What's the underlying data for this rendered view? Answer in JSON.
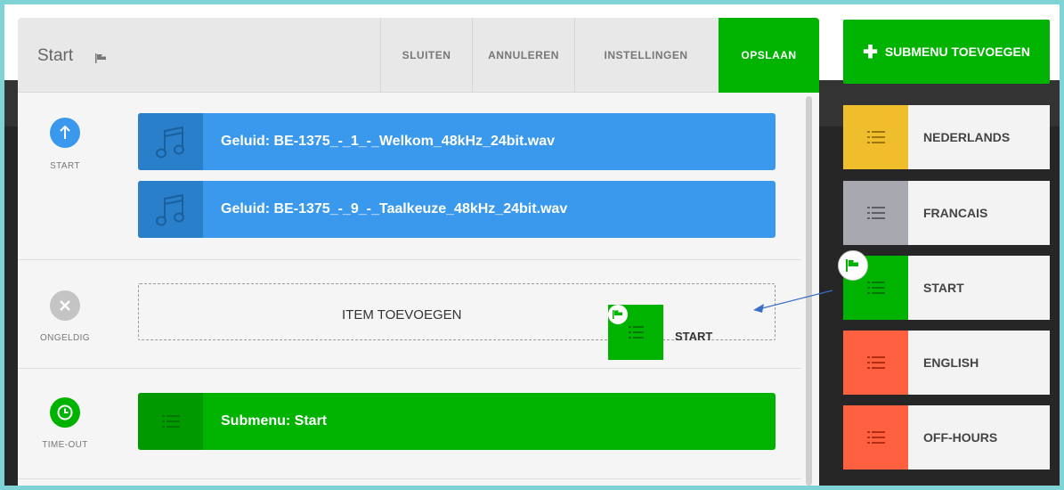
{
  "panel": {
    "title": "Start",
    "header_buttons": [
      {
        "label": "SLUITEN"
      },
      {
        "label": "ANNULEREN"
      },
      {
        "label": "INSTELLINGEN"
      },
      {
        "label": "OPSLAAN"
      }
    ]
  },
  "sections": [
    {
      "label": "START",
      "icon": "arrow-up-icon",
      "items": [
        {
          "text": "Geluid: BE-1375_-_1_-_Welkom_48kHz_24bit.wav",
          "icon": "music-note-icon"
        },
        {
          "text": "Geluid: BE-1375_-_9_-_Taalkeuze_48kHz_24bit.wav",
          "icon": "music-note-icon"
        }
      ]
    },
    {
      "label": "ONGELDIG",
      "icon": "close-icon",
      "dropzone_label": "ITEM TOEVOEGEN",
      "drag_item_label": "START"
    },
    {
      "label": "TIME-OUT",
      "icon": "clock-icon",
      "items": [
        {
          "text": "Submenu: Start",
          "icon": "list-icon"
        }
      ]
    }
  ],
  "sidebar": {
    "add_button": "SUBMENU TOEVOEGEN",
    "menus": [
      {
        "label": "NEDERLANDS",
        "color": "#f0be2c"
      },
      {
        "label": "FRANCAIS",
        "color": "#a7a8b0"
      },
      {
        "label": "START",
        "color": "#00b300"
      },
      {
        "label": "ENGLISH",
        "color": "#ff6040"
      },
      {
        "label": "OFF-HOURS",
        "color": "#ff6040"
      }
    ]
  },
  "colors": {
    "accent_green": "#00b300",
    "accent_blue": "#3a99ec",
    "frame": "#7fd3d5"
  }
}
